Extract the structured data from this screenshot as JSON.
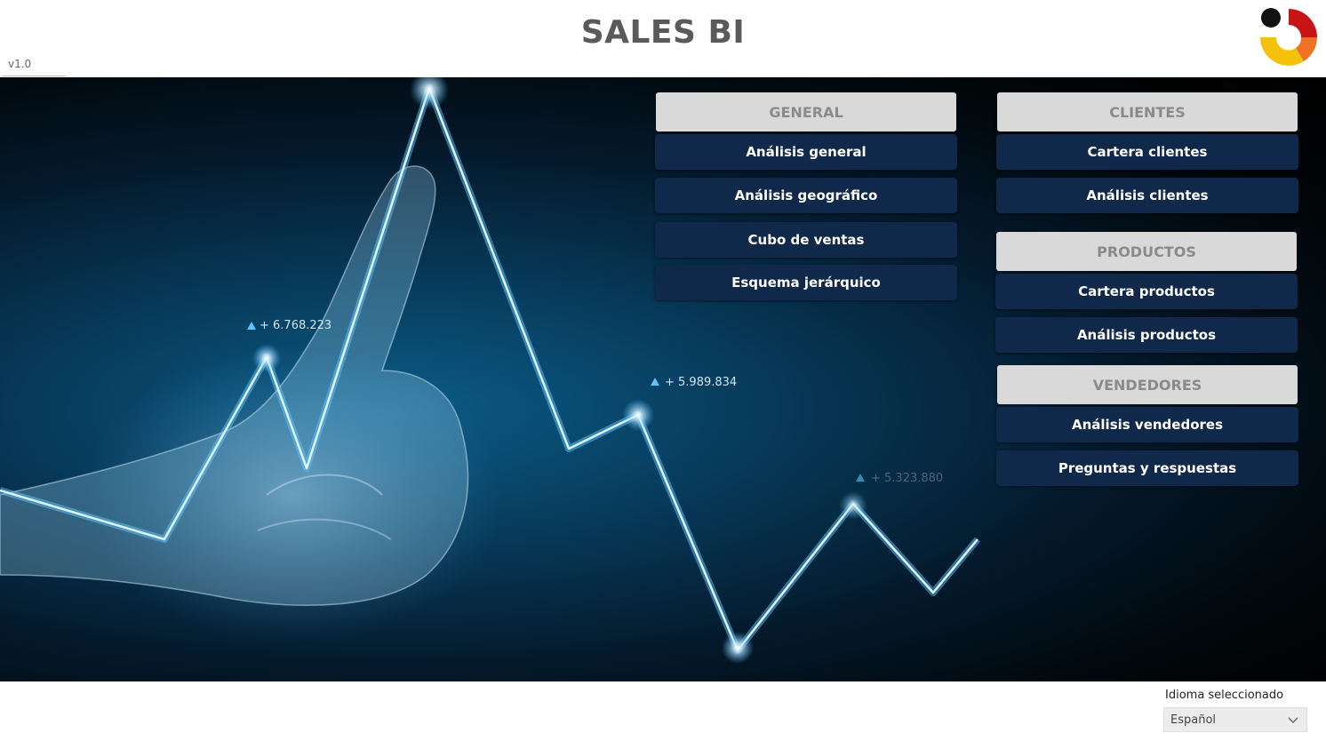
{
  "header": {
    "title": "SALES BI",
    "version": "v1.0"
  },
  "hero": {
    "annotations": [
      "+ 6.768.223",
      "+ 5.989.834",
      "+ 5.323.880"
    ]
  },
  "general": {
    "title": "GENERAL",
    "items": [
      "Análisis general",
      "Análisis geográfico",
      "Cubo de ventas",
      "Esquema jerárquico"
    ]
  },
  "clientes": {
    "title": "CLIENTES",
    "items": [
      "Cartera clientes",
      "Análisis clientes"
    ]
  },
  "productos": {
    "title": "PRODUCTOS",
    "items": [
      "Cartera productos",
      "Análisis productos"
    ]
  },
  "vendedores": {
    "title": "VENDEDORES",
    "items": [
      "Análisis vendedores",
      "Preguntas y respuestas"
    ]
  },
  "footer": {
    "language_label": "Idioma seleccionado",
    "language_value": "Español"
  },
  "colors": {
    "button_bg": "#10284a",
    "section_header_bg": "#d9d9d9",
    "title_color": "#5a5a5a"
  },
  "icons": {
    "logo": "company-logo-icon",
    "dropdown": "chevron-down-icon"
  }
}
